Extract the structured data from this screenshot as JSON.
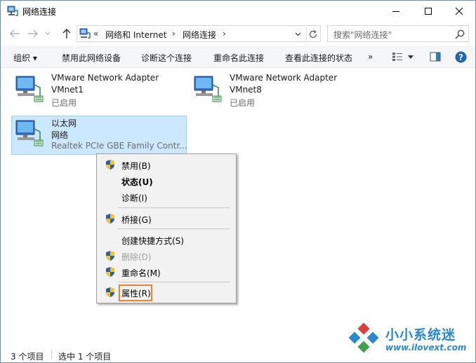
{
  "window": {
    "title": "网络连接",
    "controls": {
      "minimize": "minimize",
      "maximize": "maximize",
      "close": "close"
    }
  },
  "address_bar": {
    "overflow": "«",
    "breadcrumbs": [
      "网络和 Internet",
      "网络连接"
    ],
    "separator": "›",
    "search_placeholder": "搜索\"网络连接\""
  },
  "command_bar": {
    "items": [
      "组织 ▾",
      "禁用此网络设备",
      "诊断这个连接",
      "重命名此连接",
      "查看此连接的状态",
      "»"
    ]
  },
  "connections": [
    {
      "name": "VMware Network Adapter",
      "line2": "VMnet1",
      "status": "已启用",
      "selected": false
    },
    {
      "name": "VMware Network Adapter",
      "line2": "VMnet8",
      "status": "已启用",
      "selected": false
    },
    {
      "name": "以太网",
      "line2": "网络",
      "status": "Realtek PCIe GBE Family Contr...",
      "selected": true
    }
  ],
  "context_menu": {
    "items": [
      {
        "label": "禁用(B)",
        "shield": true,
        "bold": false,
        "disabled": false
      },
      {
        "label": "状态(U)",
        "shield": false,
        "bold": true,
        "disabled": false
      },
      {
        "label": "诊断(I)",
        "shield": false,
        "bold": false,
        "disabled": false
      },
      {
        "label": "桥接(G)",
        "shield": true,
        "bold": false,
        "disabled": false
      },
      {
        "label": "创建快捷方式(S)",
        "shield": false,
        "bold": false,
        "disabled": false
      },
      {
        "label": "删除(D)",
        "shield": true,
        "bold": false,
        "disabled": true
      },
      {
        "label": "重命名(M)",
        "shield": true,
        "bold": false,
        "disabled": false
      },
      {
        "label": "属性(R)",
        "shield": true,
        "bold": false,
        "disabled": false,
        "highlighted": true
      }
    ]
  },
  "status_bar": {
    "count": "3 个项目",
    "selection": "选中 1 个项目"
  },
  "watermark": {
    "brand": "小小系统迷",
    "url": "www.ilovext.com"
  },
  "colors": {
    "selection_bg": "#cce8ff",
    "selection_border": "#99d1ff",
    "highlight_box": "#e9852f",
    "watermark": "#2a88d0",
    "help_icon": "#1a64c2"
  }
}
